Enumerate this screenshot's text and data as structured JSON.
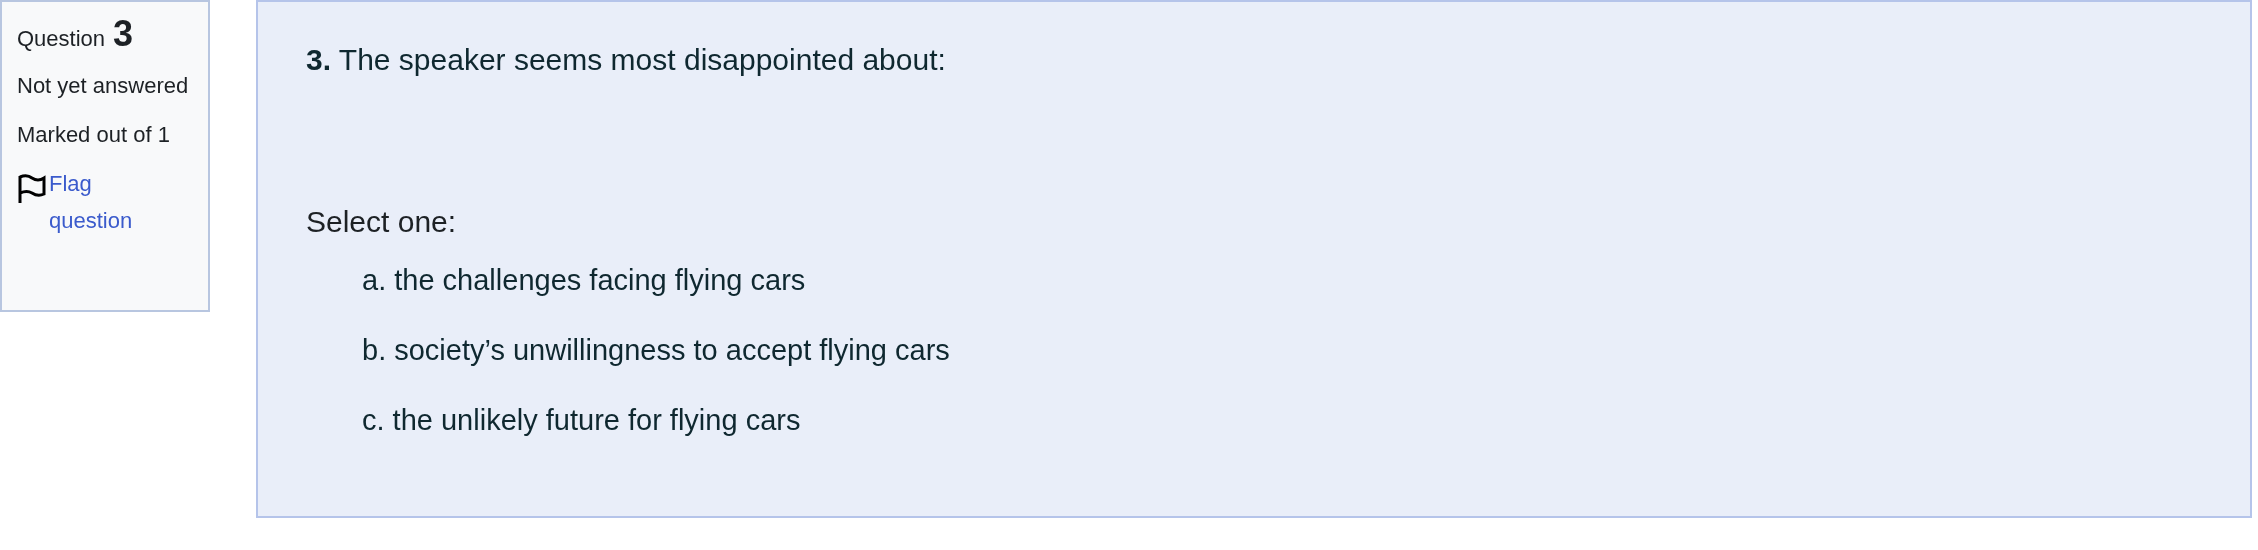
{
  "question_info": {
    "label": "Question",
    "number": "3",
    "status": "Not yet answered",
    "marks": "Marked out of 1",
    "flag_link": "Flag question"
  },
  "question": {
    "number": "3.",
    "text": "The speaker seems most disappointed about:",
    "prompt": "Select one:",
    "options": [
      {
        "text": "a. the challenges facing flying cars"
      },
      {
        "text": "b. society’s unwillingness to accept flying cars"
      },
      {
        "text": "c. the unlikely future for flying cars"
      }
    ]
  }
}
